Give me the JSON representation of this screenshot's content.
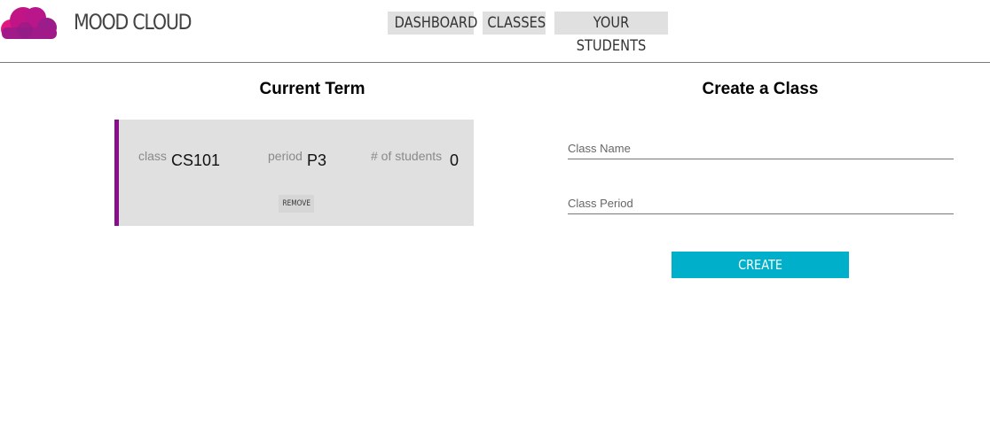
{
  "app": {
    "brand": "MOOD CLOUD",
    "logo_icon": "cloud-logo-icon",
    "colors": {
      "logo_primary": "#9b1d8c",
      "logo_secondary": "#e0177e",
      "accent": "#880e8c",
      "button": "#00afca"
    }
  },
  "nav": {
    "items": [
      {
        "label": "DASHBOARD"
      },
      {
        "label": "CLASSES"
      },
      {
        "label": "YOUR STUDENTS"
      }
    ]
  },
  "current_term": {
    "title": "Current Term",
    "classes": [
      {
        "class_label": "class",
        "class_value": "CS101",
        "period_label": "period",
        "period_value": "P3",
        "students_label": "# of students",
        "students_value": "0",
        "remove_label": "REMOVE"
      }
    ]
  },
  "create_class": {
    "title": "Create a Class",
    "name_placeholder": "Class Name",
    "name_value": "",
    "period_placeholder": "Class Period",
    "period_value": "",
    "submit_label": "CREATE"
  }
}
